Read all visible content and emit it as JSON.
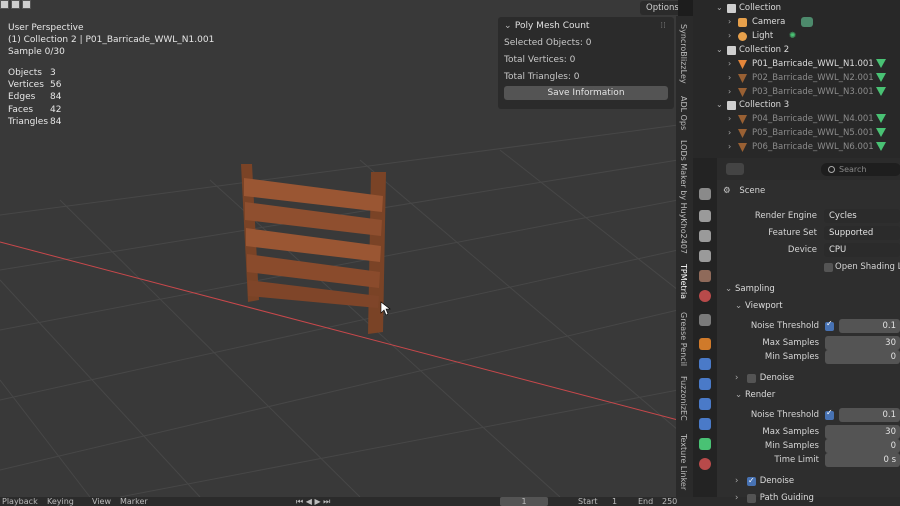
{
  "viewport": {
    "options_label": "Options",
    "hud": {
      "view_name": "User Perspective",
      "collection_object": "(1) Collection 2 | P01_Barricade_WWL_N1.001",
      "sample": "Sample 0/30"
    },
    "stats": [
      {
        "label": "Objects",
        "value": "3"
      },
      {
        "label": "Vertices",
        "value": "56"
      },
      {
        "label": "Edges",
        "value": "84"
      },
      {
        "label": "Faces",
        "value": "42"
      },
      {
        "label": "Triangles",
        "value": "84"
      }
    ],
    "poly_panel": {
      "title": "Poly Mesh Count",
      "selected_objects": "Selected Objects: 0",
      "total_vertices": "Total Vertices: 0",
      "total_triangles": "Total Triangles: 0",
      "save_button": "Save Information"
    },
    "side_tabs": [
      "SyncroBlizzLey",
      "ADL Ops",
      "LODs Maker by HuyKho2407",
      "TPMetria",
      "Grease Pencil",
      "FuzzonizEC",
      "Texture Linker"
    ],
    "active_side_tab": "TPMetria"
  },
  "timeline": {
    "playback": "Playback",
    "keying": "Keying",
    "view": "View",
    "marker": "Marker",
    "current_frame": "1",
    "start_label": "Start",
    "start_value": "1",
    "end_label": "End",
    "end_value": "250"
  },
  "outliner": {
    "rows": [
      {
        "label": "Collection",
        "kind": "collection",
        "indent": 0,
        "dim": false
      },
      {
        "label": "Camera",
        "kind": "camera",
        "indent": 1,
        "dim": false
      },
      {
        "label": "Light",
        "kind": "light",
        "indent": 1,
        "dim": false
      },
      {
        "label": "Collection 2",
        "kind": "collection",
        "indent": 0,
        "dim": false
      },
      {
        "label": "P01_Barricade_WWL_N1.001",
        "kind": "mesh",
        "indent": 1,
        "dim": false
      },
      {
        "label": "P02_Barricade_WWL_N2.001",
        "kind": "mesh",
        "indent": 1,
        "dim": true
      },
      {
        "label": "P03_Barricade_WWL_N3.001",
        "kind": "mesh",
        "indent": 1,
        "dim": true
      },
      {
        "label": "Collection 3",
        "kind": "collection",
        "indent": 0,
        "dim": false
      },
      {
        "label": "P04_Barricade_WWL_N4.001",
        "kind": "mesh",
        "indent": 1,
        "dim": true
      },
      {
        "label": "P05_Barricade_WWL_N5.001",
        "kind": "mesh",
        "indent": 1,
        "dim": true
      },
      {
        "label": "P06_Barricade_WWL_N6.001",
        "kind": "mesh",
        "indent": 1,
        "dim": true
      }
    ]
  },
  "properties": {
    "search_placeholder": "Search",
    "context": "Scene",
    "render_engine_label": "Render Engine",
    "render_engine_value": "Cycles",
    "feature_set_label": "Feature Set",
    "feature_set_value": "Supported",
    "device_label": "Device",
    "device_value": "CPU",
    "open_shading": "Open Shading Lan",
    "sampling": "Sampling",
    "viewport_section": "Viewport",
    "noise_threshold_label": "Noise Threshold",
    "noise_threshold_vp": "0.1",
    "max_samples_label": "Max Samples",
    "max_samples_vp": "30",
    "min_samples_label": "Min Samples",
    "min_samples_vp": "0",
    "denoise_label": "Denoise",
    "render_section": "Render",
    "noise_threshold_r": "0.1",
    "max_samples_r": "30",
    "min_samples_r": "0",
    "time_limit_label": "Time Limit",
    "time_limit_value": "0 s",
    "path_guiding": "Path Guiding"
  },
  "colors": {
    "accent_blue": "#4772b3",
    "mesh_green": "#49c274",
    "mesh_orange": "#e5863a",
    "x_axis_red": "#c8484b"
  }
}
